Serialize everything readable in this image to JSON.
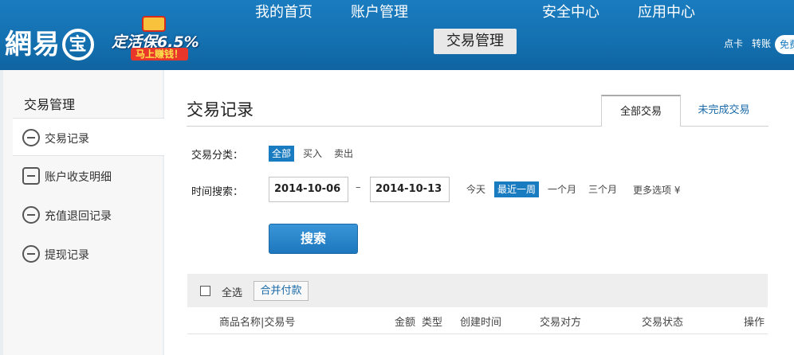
{
  "header": {
    "logo_text": "網易",
    "logo_mark": "宝",
    "promo": {
      "main": "定活保",
      "rate": "6.5%",
      "sub": "马上赚钱！"
    },
    "nav": [
      {
        "label": "我的首页",
        "active": false
      },
      {
        "label": "账户管理",
        "active": false
      },
      {
        "label": "交易管理",
        "active": true
      },
      {
        "label": "安全中心",
        "active": false
      },
      {
        "label": "应用中心",
        "active": false
      }
    ],
    "quick_links": [
      "点卡",
      "转账"
    ],
    "quick_pill": "免费"
  },
  "sidebar": {
    "title": "交易管理",
    "items": [
      {
        "label": "交易记录",
        "icon": "card-icon",
        "active": true
      },
      {
        "label": "账户收支明细",
        "icon": "transfer-icon",
        "active": false
      },
      {
        "label": "充值退回记录",
        "icon": "refund-icon",
        "active": false
      },
      {
        "label": "提现记录",
        "icon": "withdraw-icon",
        "active": false
      }
    ]
  },
  "main": {
    "title": "交易记录",
    "tabs": [
      {
        "label": "全部交易",
        "active": true
      },
      {
        "label": "未完成交易",
        "active": false
      }
    ],
    "category": {
      "label": "交易分类：",
      "options": [
        {
          "label": "全部",
          "active": true
        },
        {
          "label": "买入",
          "active": false
        },
        {
          "label": "卖出",
          "active": false
        }
      ]
    },
    "time": {
      "label": "时间搜索：",
      "start": "2014-10-06",
      "separator": "–",
      "end": "2014-10-13",
      "ranges": [
        {
          "label": "今天",
          "active": false
        },
        {
          "label": "最近一周",
          "active": true
        },
        {
          "label": "一个月",
          "active": false
        },
        {
          "label": "三个月",
          "active": false
        }
      ],
      "more": "更多选项 ¥"
    },
    "search_label": "搜索",
    "table": {
      "select_all": "全选",
      "merge_pay": "合并付款",
      "columns": [
        "商品名称|交易号",
        "金额",
        "类型",
        "创建时间",
        "交易对方",
        "交易状态",
        "操作"
      ]
    }
  },
  "colors": {
    "header_blue": "#1470b0",
    "accent": "#1a7cc0"
  }
}
